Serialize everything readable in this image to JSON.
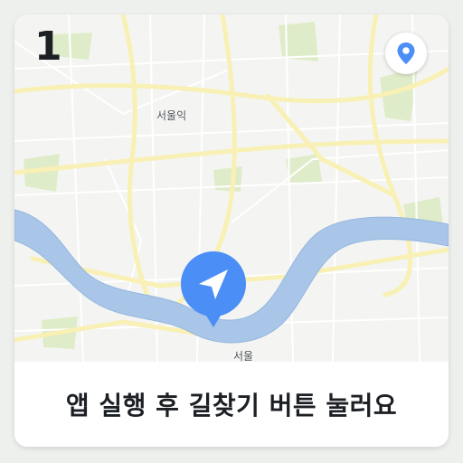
{
  "step": {
    "number": "1"
  },
  "map": {
    "labels": {
      "north": "서울익",
      "south": "서울"
    },
    "colors": {
      "background": "#f4f5f2",
      "water": "#a9c6e9",
      "road_major": "#f8f0b4",
      "road_minor": "#ffffff",
      "park": "#dfecc9",
      "navigation_accent": "#4a8ef6"
    }
  },
  "controls": {
    "location_button_icon": "location-pin-icon",
    "navigate_button_icon": "navigation-arrow-icon"
  },
  "instruction": {
    "text": "앱 실행 후 길찾기 버튼 눌러요"
  }
}
